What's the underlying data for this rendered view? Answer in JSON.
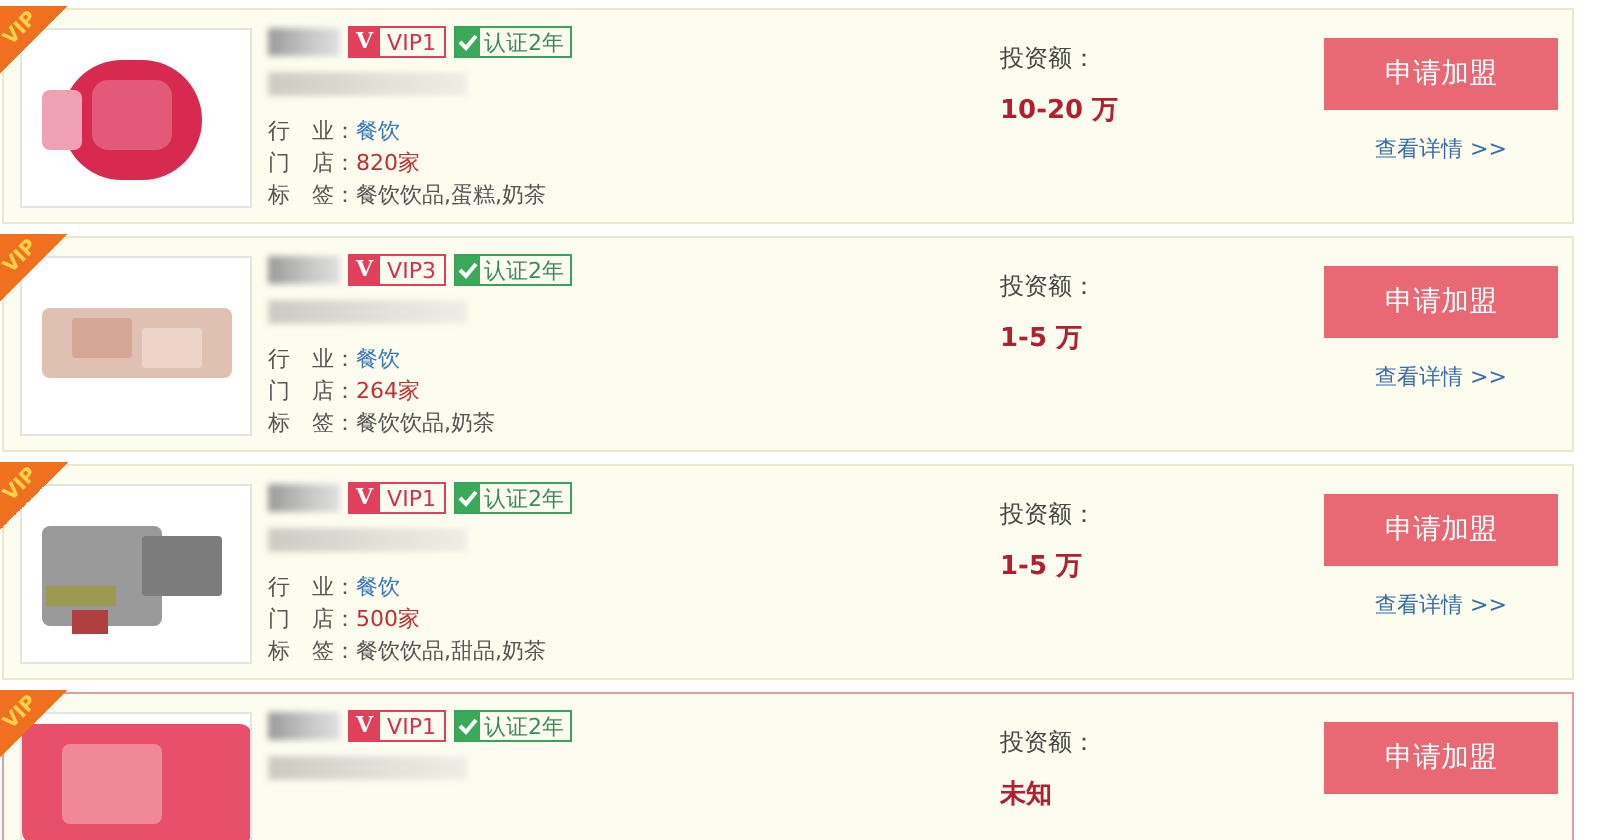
{
  "cards": [
    {
      "ribbon": "VIP",
      "highlighted": false,
      "vip_mark": "V",
      "vip": "VIP1",
      "cert": "认证2年",
      "info": [
        {
          "label": "行　业：",
          "value": "餐饮",
          "kind": "link"
        },
        {
          "label": "门　店：",
          "value": "820家",
          "kind": "count"
        },
        {
          "label": "标　签：",
          "value": "餐饮饮品,蛋糕,奶茶",
          "kind": "plain"
        }
      ],
      "budget_label": "投资额：",
      "budget": "10-20 万",
      "button": "申请加盟",
      "link": "查看详情 >>"
    },
    {
      "ribbon": "VIP",
      "highlighted": false,
      "vip_mark": "V",
      "vip": "VIP3",
      "cert": "认证2年",
      "info": [
        {
          "label": "行　业：",
          "value": "餐饮",
          "kind": "link"
        },
        {
          "label": "门　店：",
          "value": "264家",
          "kind": "count"
        },
        {
          "label": "标　签：",
          "value": "餐饮饮品,奶茶",
          "kind": "plain"
        }
      ],
      "budget_label": "投资额：",
      "budget": "1-5 万",
      "button": "申请加盟",
      "link": "查看详情 >>"
    },
    {
      "ribbon": "VIP",
      "highlighted": false,
      "vip_mark": "V",
      "vip": "VIP1",
      "cert": "认证2年",
      "info": [
        {
          "label": "行　业：",
          "value": "餐饮",
          "kind": "link"
        },
        {
          "label": "门　店：",
          "value": "500家",
          "kind": "count"
        },
        {
          "label": "标　签：",
          "value": "餐饮饮品,甜品,奶茶",
          "kind": "plain"
        }
      ],
      "budget_label": "投资额：",
      "budget": "1-5 万",
      "button": "申请加盟",
      "link": "查看详情 >>"
    },
    {
      "ribbon": "VIP",
      "highlighted": true,
      "vip_mark": "V",
      "vip": "VIP1",
      "cert": "认证2年",
      "budget_label": "投资额：",
      "budget": "未知",
      "button": "申请加盟"
    }
  ]
}
